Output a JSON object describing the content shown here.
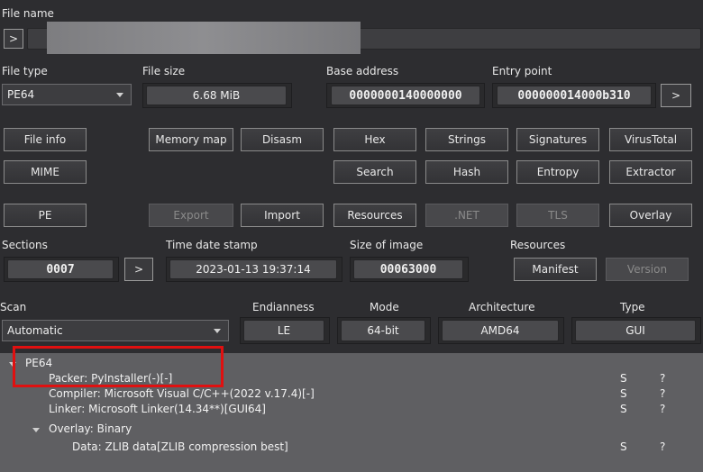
{
  "file_name": {
    "label": "File name",
    "browse_button": ">",
    "value": ""
  },
  "file_type": {
    "label": "File type",
    "value": "PE64"
  },
  "file_size": {
    "label": "File size",
    "value": "6.68 MiB"
  },
  "base_address": {
    "label": "Base address",
    "value": "0000000140000000"
  },
  "entry_point": {
    "label": "Entry point",
    "value": "000000014000b310",
    "button": ">"
  },
  "tools_row1": [
    "File info",
    "Memory map",
    "Disasm",
    "Hex",
    "Strings",
    "Signatures",
    "VirusTotal"
  ],
  "tools_row2": {
    "mime": "MIME",
    "search": "Search",
    "hash": "Hash",
    "entropy": "Entropy",
    "extractor": "Extractor"
  },
  "tools_row3": {
    "pe": "PE",
    "export": "Export",
    "import": "Import",
    "resources": "Resources",
    "net": ".NET",
    "tls": "TLS",
    "overlay": "Overlay"
  },
  "sections": {
    "label": "Sections",
    "value": "0007",
    "button": ">"
  },
  "time_date_stamp": {
    "label": "Time date stamp",
    "value": "2023-01-13 19:37:14"
  },
  "size_of_image": {
    "label": "Size of image",
    "value": "00063000"
  },
  "resources_info": {
    "label": "Resources",
    "manifest": "Manifest",
    "version": "Version"
  },
  "scan": {
    "label": "Scan",
    "value": "Automatic"
  },
  "endianness": {
    "label": "Endianness",
    "value": "LE"
  },
  "mode": {
    "label": "Mode",
    "value": "64-bit"
  },
  "architecture": {
    "label": "Architecture",
    "value": "AMD64"
  },
  "type": {
    "label": "Type",
    "value": "GUI"
  },
  "results": {
    "root": "PE64",
    "items": [
      {
        "text": "Packer: PyInstaller(-)[-]",
        "s": "S",
        "q": "?"
      },
      {
        "text": "Compiler: Microsoft Visual C/C++(2022 v.17.4)[-]",
        "s": "S",
        "q": "?"
      },
      {
        "text": "Linker: Microsoft Linker(14.34**)[GUI64]",
        "s": "S",
        "q": "?"
      }
    ],
    "overlay": "Overlay: Binary",
    "overlay_child": {
      "text": "Data: ZLIB data[ZLIB compression best]",
      "s": "S",
      "q": "?"
    }
  },
  "colors": {
    "background": "#2d2d30",
    "results_panel": "#5f5f62",
    "highlight_box": "#e01010"
  }
}
